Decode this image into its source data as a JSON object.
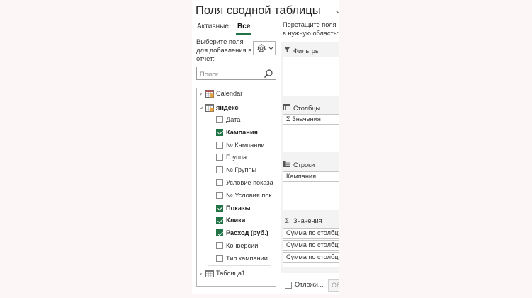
{
  "pane": {
    "title": "Поля сводной таблицы",
    "tabs": [
      {
        "label": "Активные",
        "active": false
      },
      {
        "label": "Все",
        "active": true
      }
    ],
    "choose_fields": "Выберите поля для добавления в отчет:",
    "search_placeholder": "Поиск",
    "accent_color": "#217346"
  },
  "field_list": {
    "tables": [
      {
        "name": "Calendar",
        "expanded": false
      },
      {
        "name": "яндекс",
        "expanded": true
      },
      {
        "name": "Таблица1",
        "expanded": false
      }
    ],
    "fields": [
      {
        "label": "Дата",
        "checked": false
      },
      {
        "label": "Кампания",
        "checked": true
      },
      {
        "label": "№ Кампании",
        "checked": false
      },
      {
        "label": "Группа",
        "checked": false
      },
      {
        "label": "№ Группы",
        "checked": false
      },
      {
        "label": "Условие показа",
        "checked": false
      },
      {
        "label": "№ Условия пок...",
        "checked": false
      },
      {
        "label": "Показы",
        "checked": true
      },
      {
        "label": "Клики",
        "checked": true
      },
      {
        "label": "Расход (руб.)",
        "checked": true
      },
      {
        "label": "Конверсии",
        "checked": false
      },
      {
        "label": "Тип кампании",
        "checked": false
      }
    ]
  },
  "areas": {
    "drag_text": "Перетащите поля в нужную область:",
    "filters": {
      "title": "Фильтры",
      "items": []
    },
    "columns": {
      "title": "Столбцы",
      "items": [
        "Значения"
      ]
    },
    "rows": {
      "title": "Строки",
      "items": [
        "Кампания"
      ]
    },
    "values": {
      "title": "Значения",
      "items": [
        "Сумма по столбцу",
        "Сумма по столбцу",
        "Сумма по столбцу"
      ]
    }
  },
  "footer": {
    "defer_label": "Отложи...",
    "update_label": "Обновить"
  }
}
